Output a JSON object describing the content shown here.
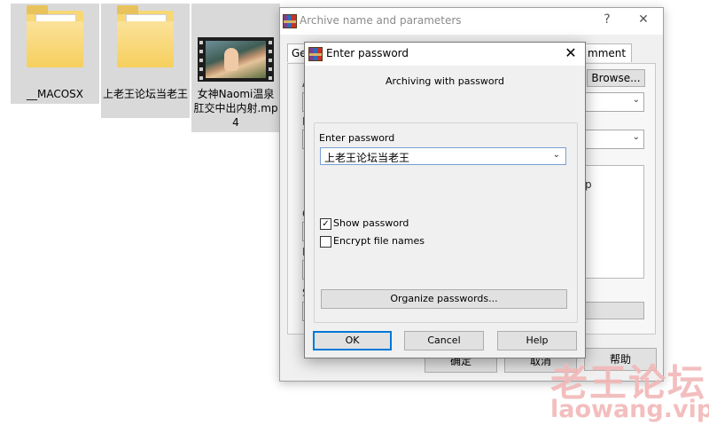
{
  "desktop": {
    "files": [
      {
        "name": "__MACOSX",
        "type": "folder"
      },
      {
        "name": "上老王论坛当老王",
        "type": "folder"
      },
      {
        "name": "女神Naomi温泉肛交中出内射.mp4",
        "type": "video"
      }
    ]
  },
  "archive_window": {
    "title": "Archive name and parameters",
    "help_label": "?",
    "close_label": "✕",
    "tabs": {
      "general_fragment": "Ge",
      "comment_fragment": "mment"
    },
    "browse_label": "Browse...",
    "ok_label": "确定",
    "cancel_label": "取消",
    "help_button_label": "帮助",
    "left_fragments": [
      "A",
      "D",
      "C",
      "D",
      "S"
    ],
    "right_fragment": "p"
  },
  "password_dialog": {
    "title": "Enter password",
    "close_label": "✕",
    "subtitle": "Archiving with password",
    "password_label": "Enter password",
    "password_value": "上老王论坛当老王",
    "show_password": {
      "label": "Show password",
      "checked": true,
      "check_mark": "✓"
    },
    "encrypt_file_names": {
      "label": "Encrypt file names",
      "checked": false
    },
    "organize_label": "Organize passwords...",
    "buttons": {
      "ok": "OK",
      "cancel": "Cancel",
      "help": "Help"
    }
  },
  "watermark": {
    "text_cn": "老王论坛",
    "text_en": "laowang.vip",
    "color": "#f2b7b7"
  },
  "colors": {
    "selection": "#d9d9d9",
    "folder": "#f8d775",
    "dialog_bg": "#f0f0f0",
    "default_button_border": "#0078d7"
  }
}
